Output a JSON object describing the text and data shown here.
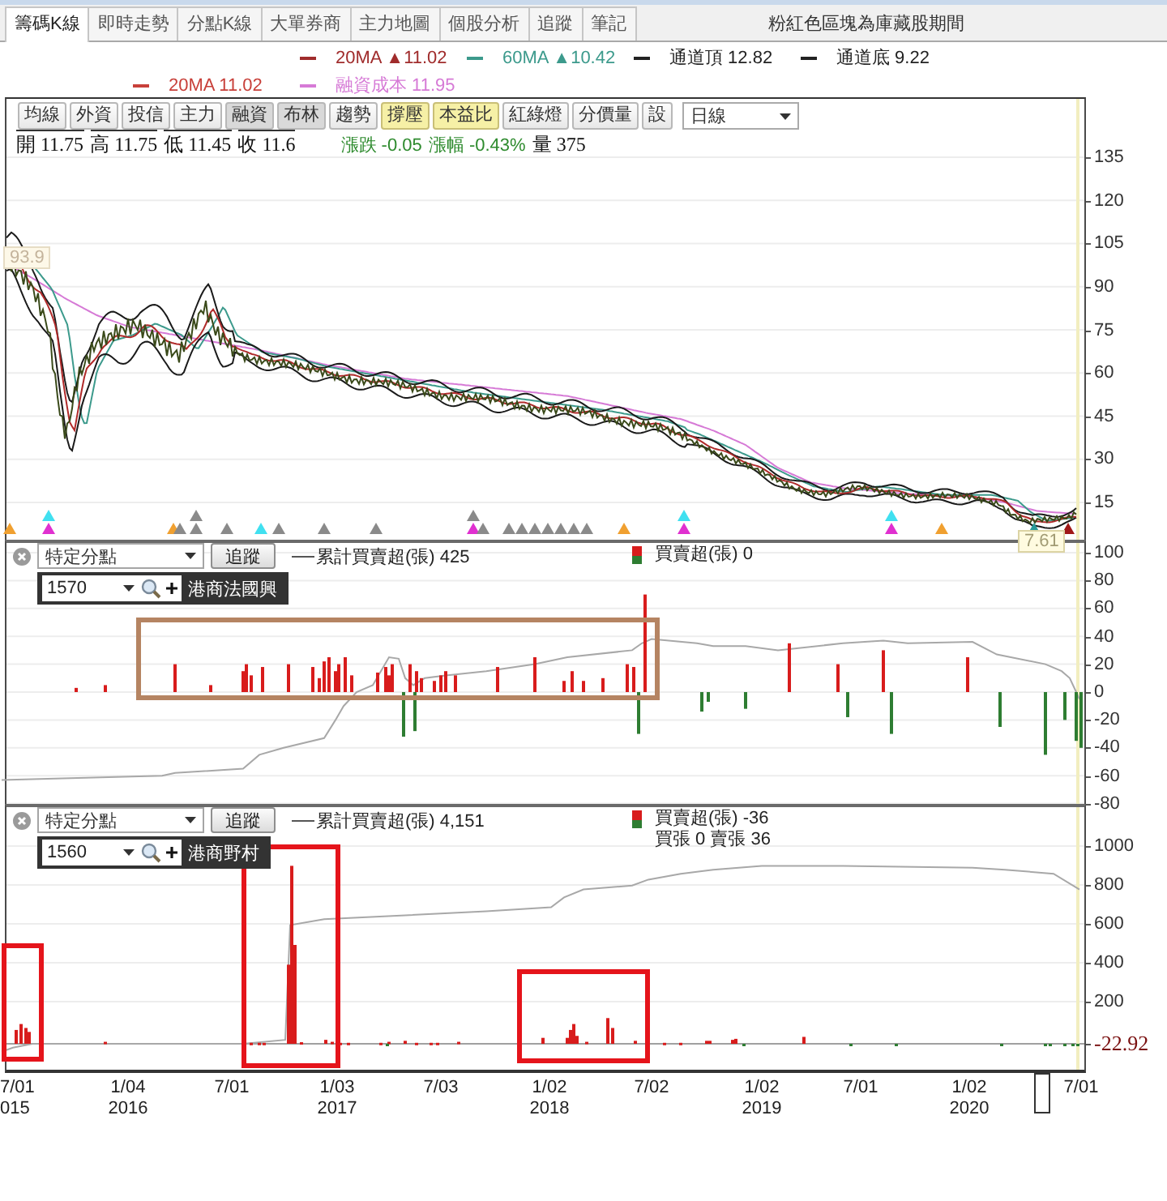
{
  "tabs": [
    {
      "label": "籌碼K線",
      "selected": true
    },
    {
      "label": "即時走勢",
      "selected": false
    },
    {
      "label": "分點K線",
      "selected": false
    },
    {
      "label": "大單券商",
      "selected": false
    },
    {
      "label": "主力地圖",
      "selected": false
    },
    {
      "label": "個股分析",
      "selected": false
    },
    {
      "label": "追蹤",
      "selected": false
    },
    {
      "label": "筆記",
      "selected": false
    }
  ],
  "notice": "粉紅色區塊為庫藏股期間",
  "legend_rows": [
    [
      {
        "text": "20MA ▲11.02",
        "color": "#a02c2c"
      },
      {
        "text": "60MA ▲10.42",
        "color": "#3c9a8c"
      },
      {
        "text": "通道頂 12.82",
        "color": "#222222"
      },
      {
        "text": "通道底 9.22",
        "color": "#222222"
      }
    ],
    [
      {
        "text": "20MA 11.02",
        "color": "#c8403a"
      },
      {
        "text": "融資成本 11.95",
        "color": "#d67ad6"
      }
    ]
  ],
  "toolbar": {
    "buttons": [
      {
        "label": "均線",
        "kind": "plain"
      },
      {
        "label": "外資",
        "kind": "plain"
      },
      {
        "label": "投信",
        "kind": "plain"
      },
      {
        "label": "主力",
        "kind": "plain"
      },
      {
        "label": "融資",
        "kind": "shaded"
      },
      {
        "label": "布林",
        "kind": "shaded"
      },
      {
        "label": "趨勢",
        "kind": "plain"
      },
      {
        "label": "撐壓",
        "kind": "highlighted"
      },
      {
        "label": "本益比",
        "kind": "highlighted"
      },
      {
        "label": "紅綠燈",
        "kind": "plain"
      },
      {
        "label": "分價量",
        "kind": "plain"
      },
      {
        "label": "設",
        "kind": "plain"
      }
    ],
    "period": "日線"
  },
  "quote": [
    {
      "text": "開 11.75",
      "kind": "price"
    },
    {
      "text": "高 11.75",
      "kind": "price"
    },
    {
      "text": "低 11.45",
      "kind": "price"
    },
    {
      "text": "收 11.6",
      "kind": "price"
    },
    {
      "text": "漲跌 -0.05",
      "kind": "change"
    },
    {
      "text": "漲幅 -0.43%",
      "kind": "change"
    },
    {
      "text": "量 375",
      "kind": "volume"
    }
  ],
  "price_panel": {
    "y_ticks": [
      "135",
      "120",
      "105",
      "90",
      "75",
      "60",
      "45",
      "30",
      "15"
    ],
    "high_label": "93.9",
    "low_label": "7.61"
  },
  "broker_panels": [
    {
      "broker_type": "特定分點",
      "track_button": "追蹤",
      "cumulative_legend": "累計買賣超(張) 425",
      "net_legend": [
        "買賣超(張) 0"
      ],
      "broker_code": "1570",
      "broker_name": "港商法國興",
      "y_ticks": [
        "100",
        "80",
        "60",
        "40",
        "20",
        "0",
        "-20",
        "-40",
        "-60",
        "-80"
      ]
    },
    {
      "broker_type": "特定分點",
      "track_button": "追蹤",
      "cumulative_legend": "累計買賣超(張) 4,151",
      "net_legend": [
        "買賣超(張) -36",
        "買張 0 賣張 36"
      ],
      "broker_code": "1560",
      "broker_name": "港商野村",
      "y_ticks": [
        "1000",
        "800",
        "600",
        "400",
        "200"
      ],
      "zero_label": "-22.92"
    }
  ],
  "time_axis": [
    {
      "date": "7/01",
      "year": "015"
    },
    {
      "date": "1/04",
      "year": "2016"
    },
    {
      "date": "7/01"
    },
    {
      "date": "1/03",
      "year": "2017"
    },
    {
      "date": "7/03"
    },
    {
      "date": "1/02",
      "year": "2018"
    },
    {
      "date": "7/02"
    },
    {
      "date": "1/02",
      "year": "2019"
    },
    {
      "date": "7/01"
    },
    {
      "date": "1/02",
      "year": "2020"
    },
    {
      "date": "7/01"
    }
  ]
}
